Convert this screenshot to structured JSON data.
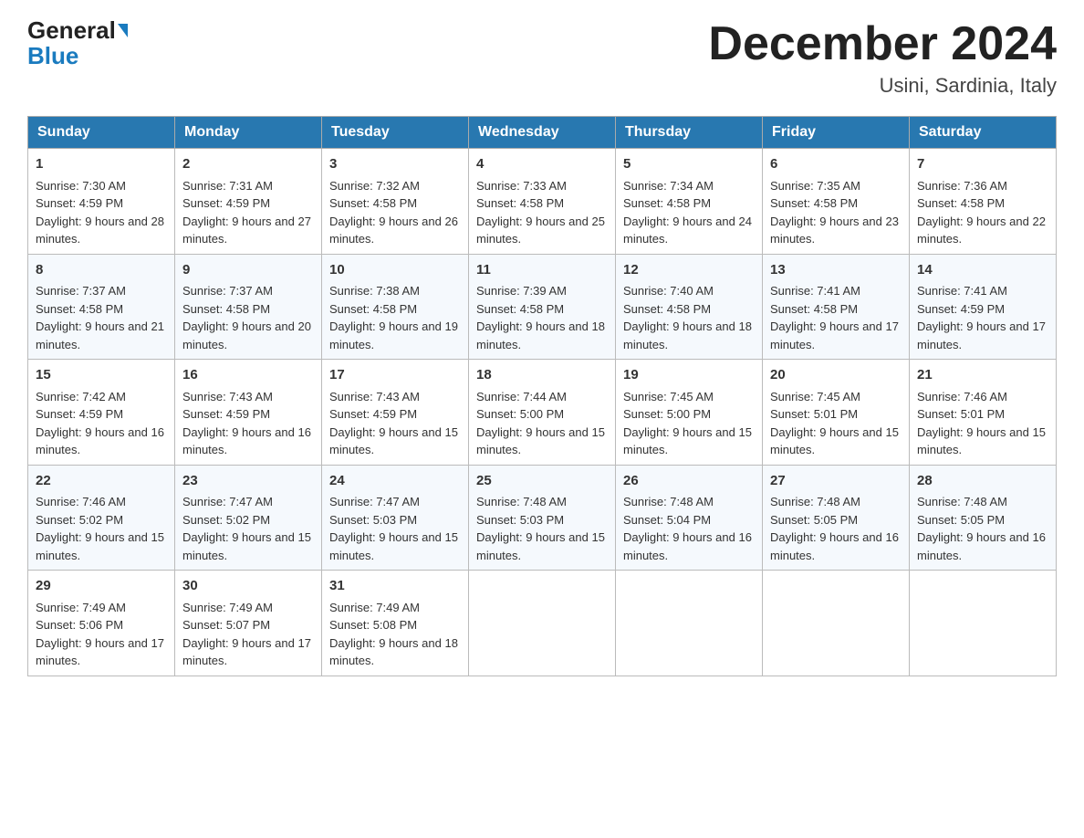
{
  "header": {
    "logo_general": "General",
    "logo_blue": "Blue",
    "month_title": "December 2024",
    "location": "Usini, Sardinia, Italy"
  },
  "days_of_week": [
    "Sunday",
    "Monday",
    "Tuesday",
    "Wednesday",
    "Thursday",
    "Friday",
    "Saturday"
  ],
  "weeks": [
    [
      {
        "day": "1",
        "sunrise": "7:30 AM",
        "sunset": "4:59 PM",
        "daylight": "9 hours and 28 minutes."
      },
      {
        "day": "2",
        "sunrise": "7:31 AM",
        "sunset": "4:59 PM",
        "daylight": "9 hours and 27 minutes."
      },
      {
        "day": "3",
        "sunrise": "7:32 AM",
        "sunset": "4:58 PM",
        "daylight": "9 hours and 26 minutes."
      },
      {
        "day": "4",
        "sunrise": "7:33 AM",
        "sunset": "4:58 PM",
        "daylight": "9 hours and 25 minutes."
      },
      {
        "day": "5",
        "sunrise": "7:34 AM",
        "sunset": "4:58 PM",
        "daylight": "9 hours and 24 minutes."
      },
      {
        "day": "6",
        "sunrise": "7:35 AM",
        "sunset": "4:58 PM",
        "daylight": "9 hours and 23 minutes."
      },
      {
        "day": "7",
        "sunrise": "7:36 AM",
        "sunset": "4:58 PM",
        "daylight": "9 hours and 22 minutes."
      }
    ],
    [
      {
        "day": "8",
        "sunrise": "7:37 AM",
        "sunset": "4:58 PM",
        "daylight": "9 hours and 21 minutes."
      },
      {
        "day": "9",
        "sunrise": "7:37 AM",
        "sunset": "4:58 PM",
        "daylight": "9 hours and 20 minutes."
      },
      {
        "day": "10",
        "sunrise": "7:38 AM",
        "sunset": "4:58 PM",
        "daylight": "9 hours and 19 minutes."
      },
      {
        "day": "11",
        "sunrise": "7:39 AM",
        "sunset": "4:58 PM",
        "daylight": "9 hours and 18 minutes."
      },
      {
        "day": "12",
        "sunrise": "7:40 AM",
        "sunset": "4:58 PM",
        "daylight": "9 hours and 18 minutes."
      },
      {
        "day": "13",
        "sunrise": "7:41 AM",
        "sunset": "4:58 PM",
        "daylight": "9 hours and 17 minutes."
      },
      {
        "day": "14",
        "sunrise": "7:41 AM",
        "sunset": "4:59 PM",
        "daylight": "9 hours and 17 minutes."
      }
    ],
    [
      {
        "day": "15",
        "sunrise": "7:42 AM",
        "sunset": "4:59 PM",
        "daylight": "9 hours and 16 minutes."
      },
      {
        "day": "16",
        "sunrise": "7:43 AM",
        "sunset": "4:59 PM",
        "daylight": "9 hours and 16 minutes."
      },
      {
        "day": "17",
        "sunrise": "7:43 AM",
        "sunset": "4:59 PM",
        "daylight": "9 hours and 15 minutes."
      },
      {
        "day": "18",
        "sunrise": "7:44 AM",
        "sunset": "5:00 PM",
        "daylight": "9 hours and 15 minutes."
      },
      {
        "day": "19",
        "sunrise": "7:45 AM",
        "sunset": "5:00 PM",
        "daylight": "9 hours and 15 minutes."
      },
      {
        "day": "20",
        "sunrise": "7:45 AM",
        "sunset": "5:01 PM",
        "daylight": "9 hours and 15 minutes."
      },
      {
        "day": "21",
        "sunrise": "7:46 AM",
        "sunset": "5:01 PM",
        "daylight": "9 hours and 15 minutes."
      }
    ],
    [
      {
        "day": "22",
        "sunrise": "7:46 AM",
        "sunset": "5:02 PM",
        "daylight": "9 hours and 15 minutes."
      },
      {
        "day": "23",
        "sunrise": "7:47 AM",
        "sunset": "5:02 PM",
        "daylight": "9 hours and 15 minutes."
      },
      {
        "day": "24",
        "sunrise": "7:47 AM",
        "sunset": "5:03 PM",
        "daylight": "9 hours and 15 minutes."
      },
      {
        "day": "25",
        "sunrise": "7:48 AM",
        "sunset": "5:03 PM",
        "daylight": "9 hours and 15 minutes."
      },
      {
        "day": "26",
        "sunrise": "7:48 AM",
        "sunset": "5:04 PM",
        "daylight": "9 hours and 16 minutes."
      },
      {
        "day": "27",
        "sunrise": "7:48 AM",
        "sunset": "5:05 PM",
        "daylight": "9 hours and 16 minutes."
      },
      {
        "day": "28",
        "sunrise": "7:48 AM",
        "sunset": "5:05 PM",
        "daylight": "9 hours and 16 minutes."
      }
    ],
    [
      {
        "day": "29",
        "sunrise": "7:49 AM",
        "sunset": "5:06 PM",
        "daylight": "9 hours and 17 minutes."
      },
      {
        "day": "30",
        "sunrise": "7:49 AM",
        "sunset": "5:07 PM",
        "daylight": "9 hours and 17 minutes."
      },
      {
        "day": "31",
        "sunrise": "7:49 AM",
        "sunset": "5:08 PM",
        "daylight": "9 hours and 18 minutes."
      },
      null,
      null,
      null,
      null
    ]
  ],
  "labels": {
    "sunrise": "Sunrise:",
    "sunset": "Sunset:",
    "daylight": "Daylight:"
  }
}
